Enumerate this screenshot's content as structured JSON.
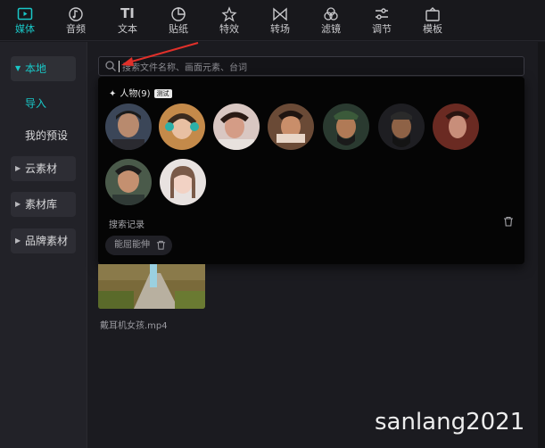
{
  "toolbar": {
    "tabs": [
      {
        "label": "媒体",
        "icon": "media-icon",
        "active": true
      },
      {
        "label": "音频",
        "icon": "audio-icon"
      },
      {
        "label": "文本",
        "icon": "text-icon"
      },
      {
        "label": "贴纸",
        "icon": "sticker-icon"
      },
      {
        "label": "特效",
        "icon": "effects-icon"
      },
      {
        "label": "转场",
        "icon": "transition-icon"
      },
      {
        "label": "滤镜",
        "icon": "filter-icon"
      },
      {
        "label": "调节",
        "icon": "adjust-icon"
      },
      {
        "label": "模板",
        "icon": "template-icon"
      }
    ]
  },
  "sidebar": {
    "local": "本地",
    "import": "导入",
    "my_presets": "我的预设",
    "cloud": "云素材",
    "library": "素材库",
    "brand": "品牌素材"
  },
  "search": {
    "placeholder": "搜索文件名称、画面元素、台词"
  },
  "dropdown": {
    "people_label": "人物(9)",
    "badge": "测试",
    "history_label": "搜索记录",
    "history_chip": "能屈能伸"
  },
  "media": {
    "file_name": "戴耳机女孩.mp4"
  },
  "watermark": "sanlang2021",
  "colors": {
    "accent": "#19c7c7",
    "arrow": "#e0302a"
  }
}
